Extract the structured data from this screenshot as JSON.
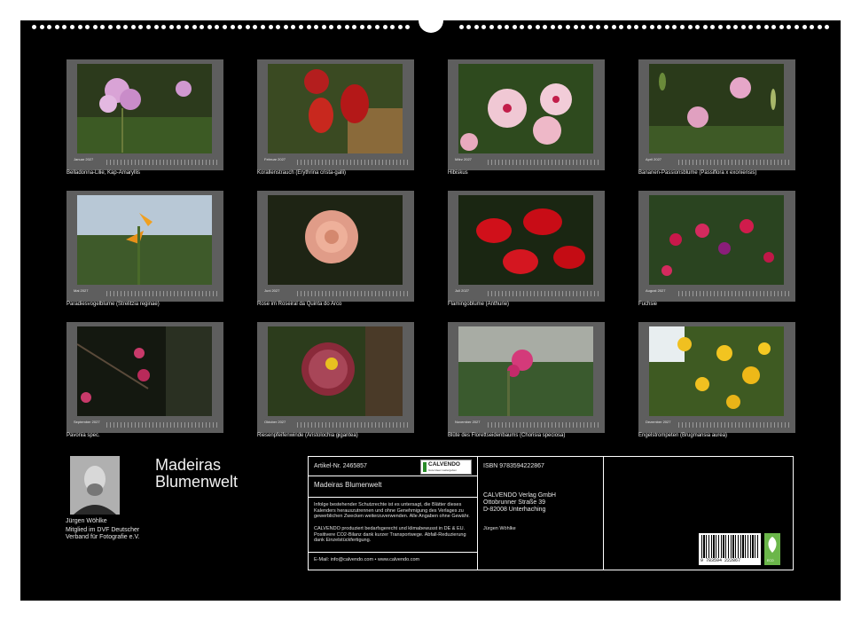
{
  "calendar": {
    "title": "Madeiras Blumenwelt",
    "months": [
      {
        "month": "Januar 2027",
        "caption": "Belladonna-Lilie, Kap-Amaryllis"
      },
      {
        "month": "Februar 2027",
        "caption": "Korallenstrauch (Erythrina crista-galli)"
      },
      {
        "month": "März 2027",
        "caption": "Hibiskus"
      },
      {
        "month": "April 2027",
        "caption": "Bananen-Passionsblume (Passiflora x exoniensis)"
      },
      {
        "month": "Mai 2027",
        "caption": "Paradiesvogelblume (Strelitzia reginae)"
      },
      {
        "month": "Juni 2027",
        "caption": "Rose im Roseiral da Quinta do Arco"
      },
      {
        "month": "Juli 2027",
        "caption": "Flamingoblume (Anthurie)"
      },
      {
        "month": "August 2027",
        "caption": "Fuchsie"
      },
      {
        "month": "September 2027",
        "caption": "Pavonia spec."
      },
      {
        "month": "Oktober 2027",
        "caption": "Riesenpfeifenwinde (Aristolochia gigantea)"
      },
      {
        "month": "November 2027",
        "caption": "Blüte des Florettseidenbaums (Chorisia speciosa)"
      },
      {
        "month": "Dezember 2027",
        "caption": "Engelstrompeten (Brugmansia aurea)"
      }
    ]
  },
  "author": {
    "name": "Jürgen Wöhlke",
    "bio": "Mitglied im DVF Deutscher Verband für Fotografie e.V."
  },
  "info": {
    "article": "Artikel-Nr. 2465857",
    "brand": "CALVENDO",
    "brand_tagline": "Gute Ideen weitergeben",
    "product_title": "Madeiras Blumenwelt",
    "legal": "Infolge bestehender Schutzrechte ist es untersagt, die Blätter dieses Kalenders herauszutrennen und ohne Genehmigung des Verlages zu gewerblichen Zwecken weiterzuverwenden. Alle Angaben ohne Gewähr.",
    "eco_note": "CALVENDO produziert bedarfsgerecht und klimabewusst in DE & EU. Positivere CO2-Bilanz dank kurzer Transportwege. Abfall-Reduzierung dank Einzelstückfertigung.",
    "contact": "E-Mail: info@calvendo.com • www.calvendo.com",
    "isbn": "ISBN 9783594222867",
    "publisher_name": "CALVENDO Verlag GmbH",
    "publisher_street": "Ottobrunner Straße 39",
    "publisher_city": "D-82008 Unterhaching",
    "author_credit": "Jürgen Wöhlke",
    "barcode_number": "9 783594 222867",
    "eco_label": "ECO"
  }
}
